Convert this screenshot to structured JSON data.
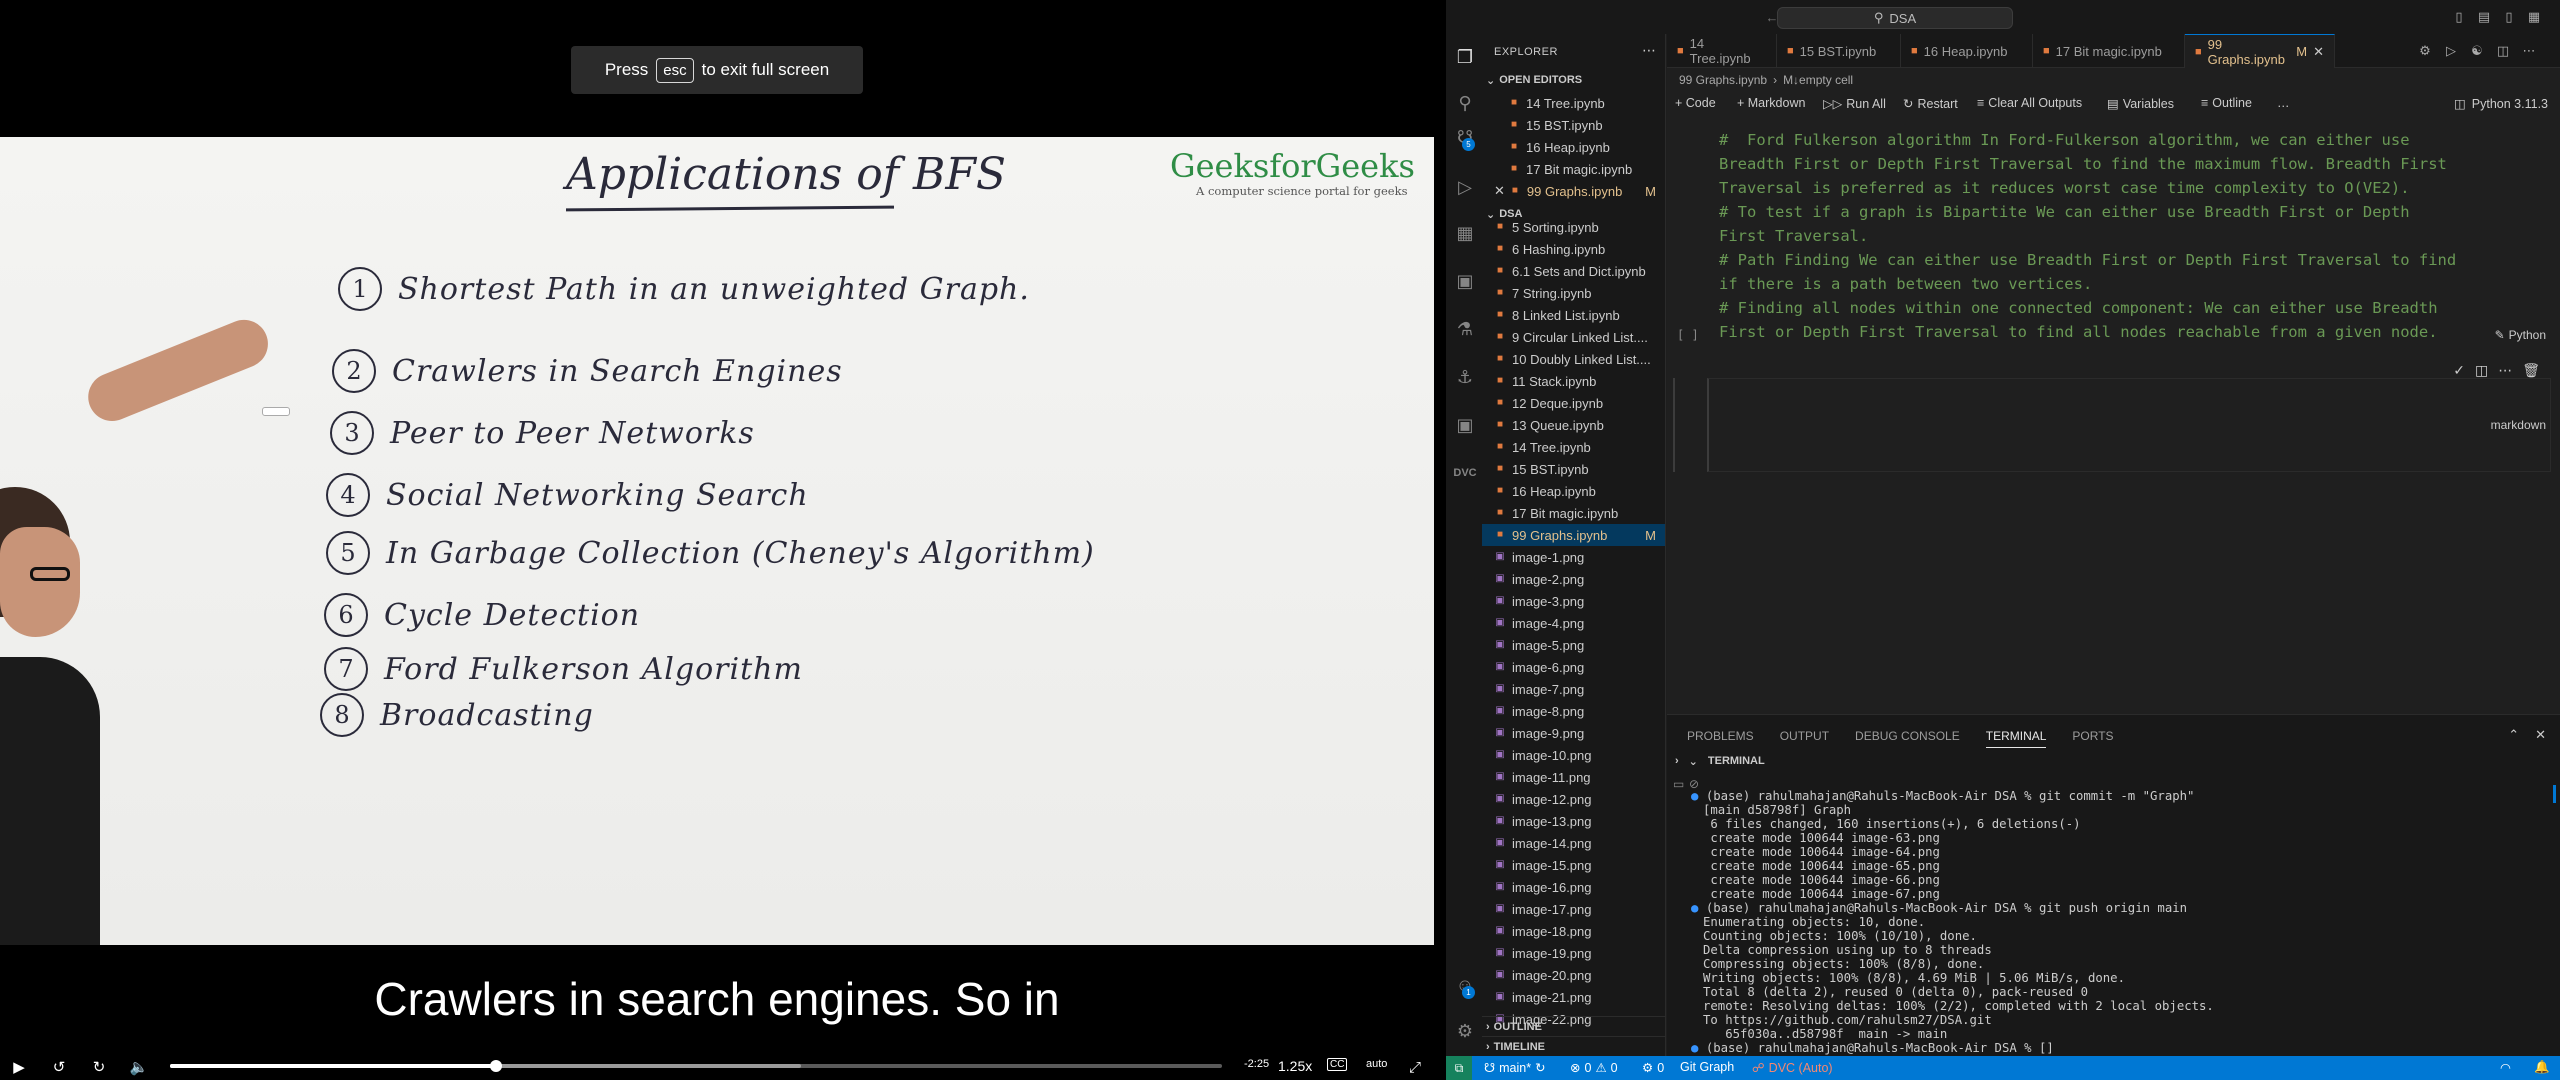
{
  "video": {
    "esc_toast": {
      "prefix": "Press",
      "key": "esc",
      "suffix": "to exit full screen"
    },
    "whiteboard": {
      "title": "Applications of BFS",
      "logo": "GeeksforGeeks",
      "logo_tagline": "A computer science portal for geeks",
      "items": [
        {
          "num": "1",
          "text": "Shortest Path in an unweighted Graph."
        },
        {
          "num": "2",
          "text": "Crawlers in Search Engines"
        },
        {
          "num": "3",
          "text": "Peer to Peer Networks"
        },
        {
          "num": "4",
          "text": "Social Networking Search"
        },
        {
          "num": "5",
          "text": "In Garbage Collection (Cheney's Algorithm)"
        },
        {
          "num": "6",
          "text": "Cycle Detection"
        },
        {
          "num": "7",
          "text": "Ford Fulkerson Algorithm"
        },
        {
          "num": "8",
          "text": "Broadcasting"
        }
      ]
    },
    "subtitle": "Crawlers in search engines. So in",
    "player": {
      "progress_fraction": 0.31,
      "buffered_fraction": 0.6,
      "time_remaining": "-2:25",
      "speed": "1.25x",
      "quality": "auto",
      "cc_label": "CC"
    }
  },
  "vscode": {
    "search_text": "DSA",
    "explorer_title": "EXPLORER",
    "open_editors_label": "OPEN EDITORS",
    "open_editors": [
      {
        "name": "14 Tree.ipynb"
      },
      {
        "name": "15 BST.ipynb"
      },
      {
        "name": "16 Heap.ipynb"
      },
      {
        "name": "17 Bit magic.ipynb"
      },
      {
        "name": "99 Graphs.ipynb",
        "modified": "M"
      }
    ],
    "folder_label": "DSA",
    "files": [
      "5 Sorting.ipynb",
      "6 Hashing.ipynb",
      "6.1 Sets and Dict.ipynb",
      "7 String.ipynb",
      "8 Linked List.ipynb",
      "9 Circular Linked List....",
      "10 Doubly Linked List....",
      "11 Stack.ipynb",
      "12 Deque.ipynb",
      "13 Queue.ipynb",
      "14 Tree.ipynb",
      "15 BST.ipynb",
      "16 Heap.ipynb",
      "17 Bit magic.ipynb"
    ],
    "active_file": {
      "name": "99 Graphs.ipynb",
      "modified": "M"
    },
    "images": [
      "image-1.png",
      "image-2.png",
      "image-3.png",
      "image-4.png",
      "image-5.png",
      "image-6.png",
      "image-7.png",
      "image-8.png",
      "image-9.png",
      "image-10.png",
      "image-11.png",
      "image-12.png",
      "image-13.png",
      "image-14.png",
      "image-15.png",
      "image-16.png",
      "image-17.png",
      "image-18.png",
      "image-19.png",
      "image-20.png",
      "image-21.png",
      "image-22.png"
    ],
    "outline_label": "OUTLINE",
    "timeline_label": "TIMELINE",
    "tabs": [
      {
        "label": "14 Tree.ipynb"
      },
      {
        "label": "15 BST.ipynb"
      },
      {
        "label": "16 Heap.ipynb"
      },
      {
        "label": "17 Bit magic.ipynb"
      },
      {
        "label": "99 Graphs.ipynb",
        "modified": "M"
      }
    ],
    "breadcrumb": [
      "99 Graphs.ipynb",
      "M↓empty cell"
    ],
    "toolbar": {
      "code": "+ Code",
      "markdown": "+ Markdown",
      "run_all": "Run All",
      "restart": "Restart",
      "clear": "Clear All Outputs",
      "variables": "Variables",
      "outline": "Outline",
      "more": "…",
      "kernel": "Python 3.11.3"
    },
    "cell_lines": [
      "#  Ford Fulkerson algorithm In Ford-Fulkerson algorithm, we can either use",
      "Breadth First or Depth First Traversal to find the maximum flow. Breadth First",
      "Traversal is preferred as it reduces worst case time complexity to O(VE2).",
      "# To test if a graph is Bipartite We can either use Breadth First or Depth",
      "First Traversal.",
      "# Path Finding We can either use Breadth First or Depth First Traversal to find",
      "if there is a path between two vertices.",
      "# Finding all nodes within one connected component: We can either use Breadth",
      "First or Depth First Traversal to find all nodes reachable from a given node."
    ],
    "cell_exec": "[ ]",
    "cell_lang": "Python",
    "empty_cell_lang": "markdown",
    "panel_tabs": [
      "PROBLEMS",
      "OUTPUT",
      "DEBUG CONSOLE",
      "TERMINAL",
      "PORTS"
    ],
    "terminal_title": "TERMINAL",
    "terminal_lines": [
      "(base) rahulmahajan@Rahuls-MacBook-Air DSA % git commit -m \"Graph\"",
      "[main d58798f] Graph",
      " 6 files changed, 160 insertions(+), 6 deletions(-)",
      " create mode 100644 image-63.png",
      " create mode 100644 image-64.png",
      " create mode 100644 image-65.png",
      " create mode 100644 image-66.png",
      " create mode 100644 image-67.png",
      "(base) rahulmahajan@Rahuls-MacBook-Air DSA % git push origin main",
      "Enumerating objects: 10, done.",
      "Counting objects: 100% (10/10), done.",
      "Delta compression using up to 8 threads",
      "Compressing objects: 100% (8/8), done.",
      "Writing objects: 100% (8/8), 4.69 MiB | 5.06 MiB/s, done.",
      "Total 8 (delta 2), reused 0 (delta 0), pack-reused 0",
      "remote: Resolving deltas: 100% (2/2), completed with 2 local objects.",
      "To https://github.com/rahulsm27/DSA.git",
      "   65f030a..d58798f  main -> main",
      "(base) rahulmahajan@Rahuls-MacBook-Air DSA % []"
    ],
    "status": {
      "branch": "main*",
      "errors": "0",
      "warnings": "0",
      "ports": "0",
      "git_graph": "Git Graph",
      "dvc": "DVC (Auto)"
    }
  }
}
